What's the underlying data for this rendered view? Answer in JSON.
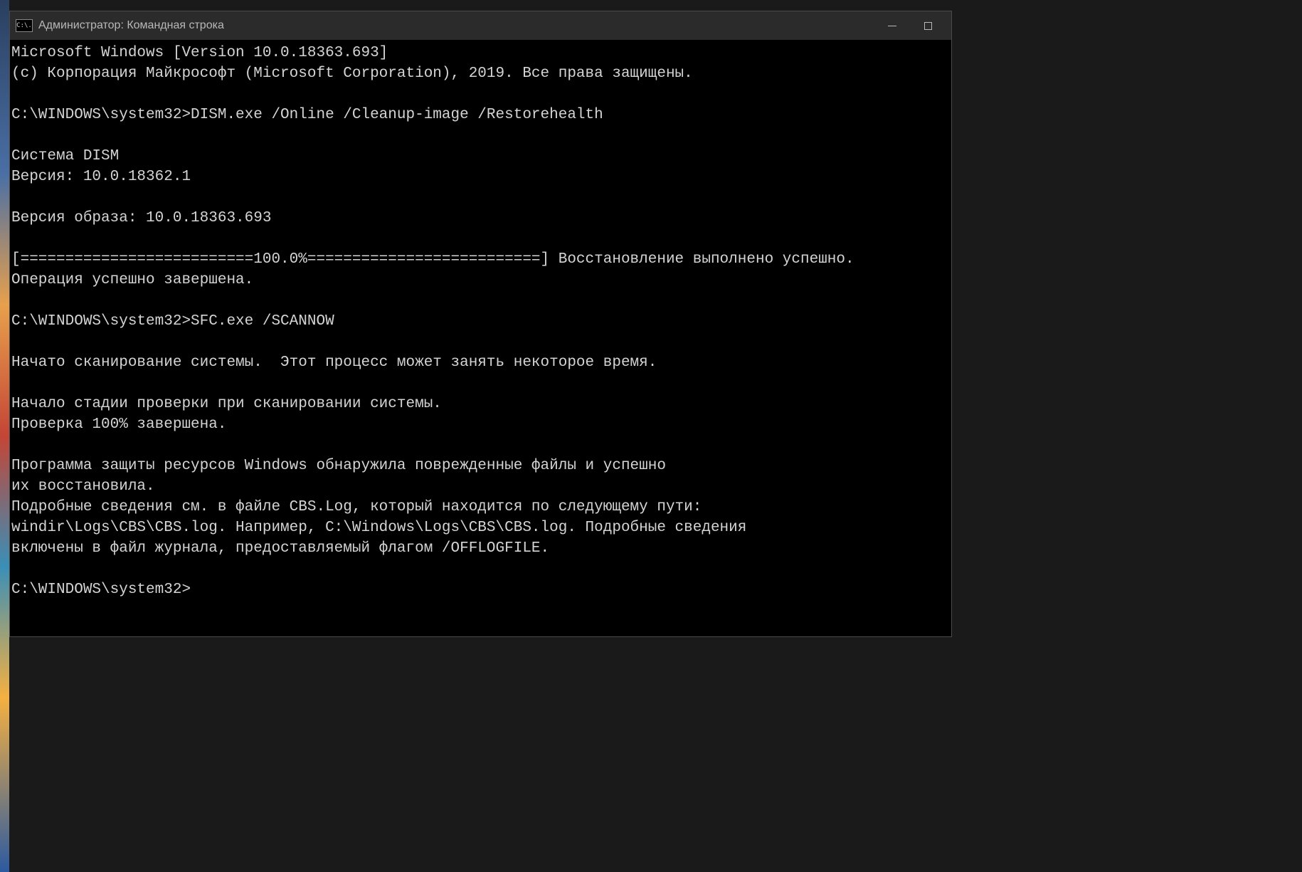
{
  "window": {
    "title": "Администратор: Командная строка",
    "icon_label": "C:\\."
  },
  "terminal": {
    "lines": [
      "Microsoft Windows [Version 10.0.18363.693]",
      "(c) Корпорация Майкрософт (Microsoft Corporation), 2019. Все права защищены.",
      "",
      "C:\\WINDOWS\\system32>DISM.exe /Online /Cleanup-image /Restorehealth",
      "",
      "Cистема DISM",
      "Версия: 10.0.18362.1",
      "",
      "Версия образа: 10.0.18363.693",
      "",
      "[==========================100.0%==========================] Восстановление выполнено успешно.",
      "Операция успешно завершена.",
      "",
      "C:\\WINDOWS\\system32>SFC.exe /SCANNOW",
      "",
      "Начато сканирование системы.  Этот процесс может занять некоторое время.",
      "",
      "Начало стадии проверки при сканировании системы.",
      "Проверка 100% завершена.",
      "",
      "Программа защиты ресурсов Windows обнаружила поврежденные файлы и успешно",
      "их восстановила.",
      "Подробные сведения см. в файле CBS.Log, который находится по следующему пути:",
      "windir\\Logs\\CBS\\CBS.log. Например, C:\\Windows\\Logs\\CBS\\CBS.log. Подробные сведения",
      "включены в файл журнала, предоставляемый флагом /OFFLOGFILE.",
      "",
      "C:\\WINDOWS\\system32>"
    ]
  }
}
